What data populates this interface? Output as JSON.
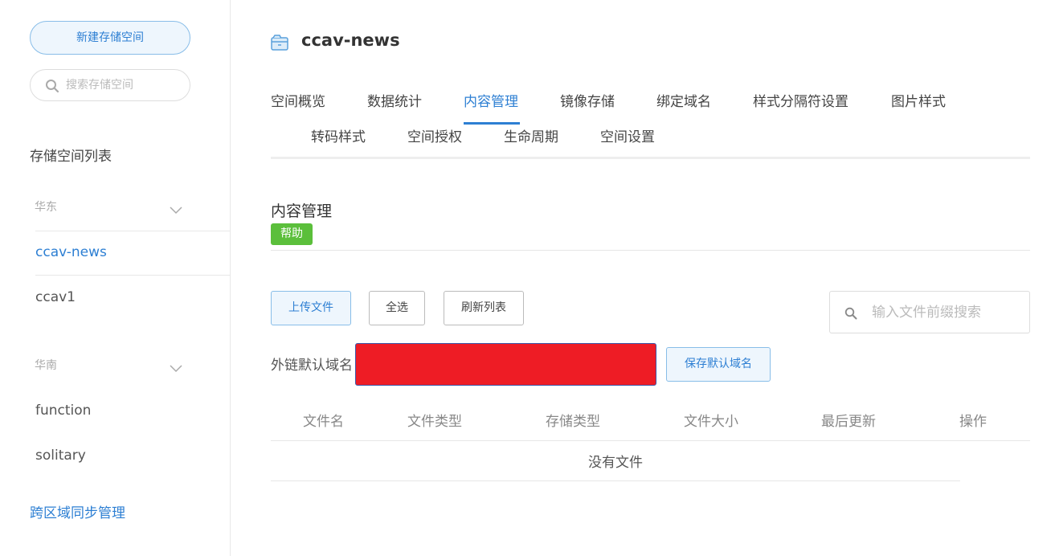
{
  "sidebar": {
    "new_bucket_label": "新建存储空间",
    "search_placeholder": "搜索存储空间",
    "list_title": "存储空间列表",
    "regions": [
      {
        "name": "华东",
        "buckets": [
          "ccav-news",
          "ccav1"
        ]
      },
      {
        "name": "华南",
        "buckets": [
          "function",
          "solitary"
        ]
      }
    ],
    "active_bucket": "ccav-news",
    "cross_region_link": "跨区域同步管理"
  },
  "header": {
    "bucket_name": "ccav-news",
    "bucket_icon": "bucket-icon"
  },
  "tabs": [
    "空间概览",
    "数据统计",
    "内容管理",
    "镜像存储",
    "绑定域名",
    "样式分隔符设置",
    "图片样式",
    "转码样式",
    "空间授权",
    "生命周期",
    "空间设置"
  ],
  "active_tab": "内容管理",
  "content": {
    "section_title": "内容管理",
    "help_label": "帮助",
    "upload_label": "上传文件",
    "select_all_label": "全选",
    "refresh_label": "刷新列表",
    "file_search_placeholder": "输入文件前缀搜索",
    "domain_label": "外链默认域名",
    "save_domain_label": "保存默认域名",
    "table_headers": [
      "文件名",
      "文件类型",
      "存储类型",
      "文件大小",
      "最后更新",
      "操作"
    ],
    "empty_text": "没有文件"
  },
  "colors": {
    "accent": "#2d7fd3",
    "help_green": "#5bbf3b",
    "redacted": "#ee1c25"
  }
}
